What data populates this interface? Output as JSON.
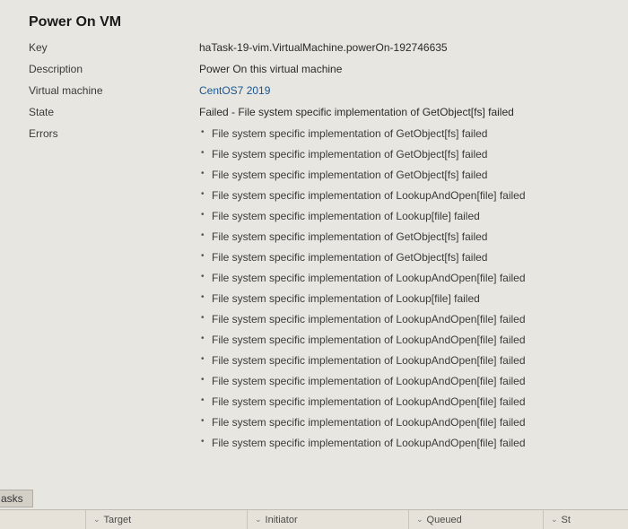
{
  "title": "Power On VM",
  "fields": {
    "key_label": "Key",
    "key_value": "haTask-19-vim.VirtualMachine.powerOn-192746635",
    "description_label": "Description",
    "description_value": "Power On this virtual machine",
    "vm_label": "Virtual machine",
    "vm_value": "CentOS7 2019",
    "state_label": "State",
    "state_value": "Failed - File system specific implementation of GetObject[fs] failed",
    "errors_label": "Errors"
  },
  "errors": [
    "File system specific implementation of GetObject[fs] failed",
    "File system specific implementation of GetObject[fs] failed",
    "File system specific implementation of GetObject[fs] failed",
    "File system specific implementation of LookupAndOpen[file] failed",
    "File system specific implementation of Lookup[file] failed",
    "File system specific implementation of GetObject[fs] failed",
    "File system specific implementation of GetObject[fs] failed",
    "File system specific implementation of LookupAndOpen[file] failed",
    "File system specific implementation of Lookup[file] failed",
    "File system specific implementation of LookupAndOpen[file] failed",
    "File system specific implementation of LookupAndOpen[file] failed",
    "File system specific implementation of LookupAndOpen[file] failed",
    "File system specific implementation of LookupAndOpen[file] failed",
    "File system specific implementation of LookupAndOpen[file] failed",
    "File system specific implementation of LookupAndOpen[file] failed",
    "File system specific implementation of LookupAndOpen[file] failed"
  ],
  "bottom_tab": "asks",
  "columns": {
    "target": "Target",
    "initiator": "Initiator",
    "queued": "Queued",
    "st": "St"
  }
}
